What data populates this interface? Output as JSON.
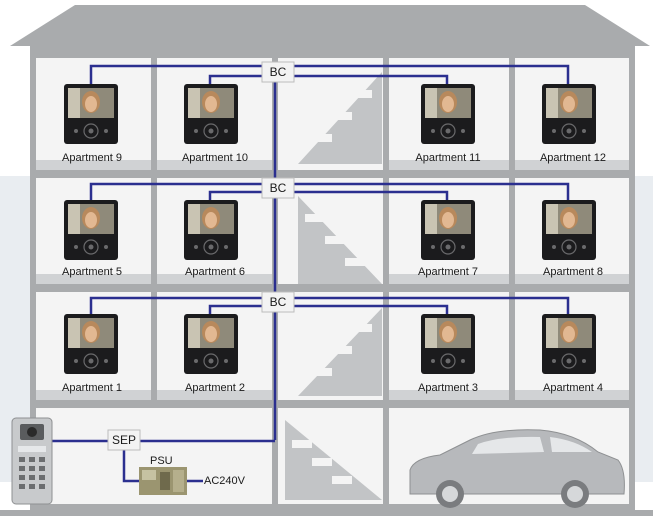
{
  "diagram": {
    "apartments": [
      {
        "label": "Apartment 9"
      },
      {
        "label": "Apartment 10"
      },
      {
        "label": "Apartment 11"
      },
      {
        "label": "Apartment 12"
      },
      {
        "label": "Apartment 5"
      },
      {
        "label": "Apartment 6"
      },
      {
        "label": "Apartment 7"
      },
      {
        "label": "Apartment 8"
      },
      {
        "label": "Apartment 1"
      },
      {
        "label": "Apartment 2"
      },
      {
        "label": "Apartment 3"
      },
      {
        "label": "Apartment 4"
      }
    ],
    "bc_boxes": [
      {
        "label": "BC"
      },
      {
        "label": "BC"
      },
      {
        "label": "BC"
      }
    ],
    "sep": {
      "label": "SEP"
    },
    "psu": {
      "label": "PSU"
    },
    "mains": {
      "label": "AC240V"
    },
    "colors": {
      "building": "#a9abad",
      "wall_inner": "#f4f4f4",
      "cable": "#2b2f8f",
      "backdrop": "#e9edf1"
    },
    "icons": [
      "monitor-icon",
      "door-station-icon",
      "car-icon",
      "staircase-icon",
      "power-supply-icon"
    ]
  }
}
